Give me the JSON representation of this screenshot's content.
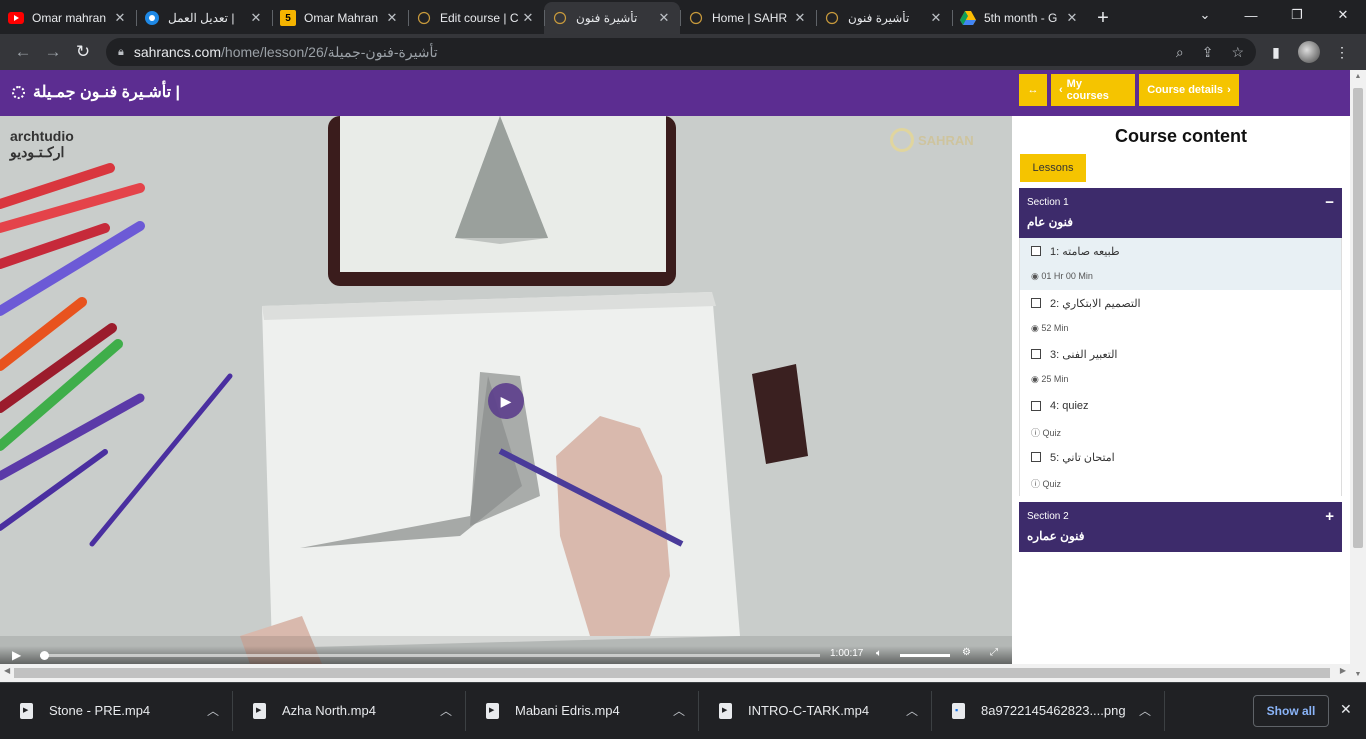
{
  "browser": {
    "tabs": [
      {
        "title": "Omar mahran",
        "favicon": "youtube-icon",
        "active": false
      },
      {
        "title": "تعديل العمل |",
        "favicon": "circle-icon",
        "active": false
      },
      {
        "title": "Omar Mahran",
        "favicon": "number-5-icon",
        "active": false
      },
      {
        "title": "Edit course | C",
        "favicon": "spinner-icon",
        "active": false
      },
      {
        "title": "تأشيرة فنون",
        "favicon": "spinner-icon",
        "active": true
      },
      {
        "title": "Home | SAHR",
        "favicon": "spinner-icon",
        "active": false
      },
      {
        "title": "تأشيرة فنون",
        "favicon": "spinner-icon",
        "active": false
      },
      {
        "title": "5th month - G",
        "favicon": "drive-icon",
        "active": false
      }
    ],
    "new_tab": "+",
    "url_domain": "sahrancs.com",
    "url_path": "/home/lesson/26/تأشيرة-فنون-جميلة"
  },
  "header": {
    "course_title": "تأشـيرة فنـون جمـيلة |",
    "toggle_label": "↔",
    "my_courses_label": "My courses",
    "course_details_label": "Course details"
  },
  "video": {
    "watermark_left_1": "archtudio",
    "watermark_left_2": "ارکـتـوديو",
    "watermark_right": "SAHRAN",
    "time": "1:00:17"
  },
  "sidebar": {
    "heading": "Course content",
    "lessons_tab": "Lessons",
    "sections": [
      {
        "label": "Section 1",
        "name": "فنون عام",
        "toggle": "−",
        "lessons": [
          {
            "title": "1: طبيعه صامته",
            "meta": "01 Hr 00 Min",
            "meta_icon": "play-circle-icon"
          },
          {
            "title": "2: التصميم الابتكاري",
            "meta": "52 Min",
            "meta_icon": "play-circle-icon"
          },
          {
            "title": "3: التعبير الفنى",
            "meta": "25 Min",
            "meta_icon": "play-circle-icon"
          },
          {
            "title": "4: quiez",
            "meta": "Quiz",
            "meta_icon": "question-circle-icon"
          },
          {
            "title": "5: امتحان تاني",
            "meta": "Quiz",
            "meta_icon": "question-circle-icon"
          }
        ]
      },
      {
        "label": "Section 2",
        "name": "فنون عماره",
        "toggle": "+"
      }
    ]
  },
  "downloads": {
    "items": [
      {
        "name": "Stone - PRE.mp4",
        "type": "video"
      },
      {
        "name": "Azha North.mp4",
        "type": "video"
      },
      {
        "name": "Mabani Edris.mp4",
        "type": "video"
      },
      {
        "name": "INTRO-C-TARK.mp4",
        "type": "video"
      },
      {
        "name": "8a9722145462823....png",
        "type": "image"
      }
    ],
    "show_all": "Show all"
  },
  "colors": {
    "header_purple": "#5c2d91",
    "section_purple": "#3d2b6b",
    "accent_yellow": "#f5c400"
  }
}
